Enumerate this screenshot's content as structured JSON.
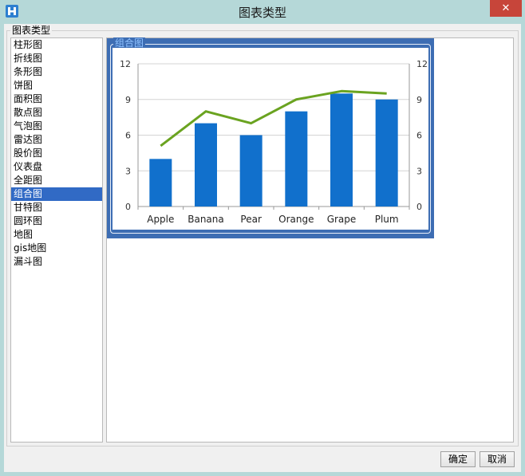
{
  "window": {
    "title": "图表类型",
    "close_label": "✕"
  },
  "group_label": "图表类型",
  "chart_types": [
    {
      "label": "柱形图"
    },
    {
      "label": "折线图"
    },
    {
      "label": "条形图"
    },
    {
      "label": "饼图"
    },
    {
      "label": "面积图"
    },
    {
      "label": "散点图"
    },
    {
      "label": "气泡图"
    },
    {
      "label": "雷达图"
    },
    {
      "label": "股价图"
    },
    {
      "label": "仪表盘"
    },
    {
      "label": "全距图"
    },
    {
      "label": "组合图",
      "selected": true
    },
    {
      "label": "甘特图"
    },
    {
      "label": "圆环图"
    },
    {
      "label": "地图"
    },
    {
      "label": "gis地图"
    },
    {
      "label": "漏斗图"
    }
  ],
  "preview": {
    "legend": "组合图"
  },
  "buttons": {
    "ok": "确定",
    "cancel": "取消"
  },
  "colors": {
    "accent": "#316ac5",
    "bar": "#1170cc",
    "line": "#6aa320",
    "frame": "#3d6db3"
  },
  "chart_data": {
    "type": "bar",
    "categories": [
      "Apple",
      "Banana",
      "Pear",
      "Orange",
      "Grape",
      "Plum"
    ],
    "series": [
      {
        "values": [
          4,
          7,
          6,
          8,
          9.5,
          9
        ],
        "kind": "bar"
      },
      {
        "values": [
          5.1,
          8,
          7,
          9,
          9.7,
          9.5
        ],
        "kind": "line"
      }
    ],
    "ylim": [
      0,
      12
    ],
    "yticks": [
      0,
      3,
      6,
      9,
      12
    ],
    "secondary_yticks": [
      0,
      3,
      6,
      9,
      12
    ],
    "grid": true
  }
}
